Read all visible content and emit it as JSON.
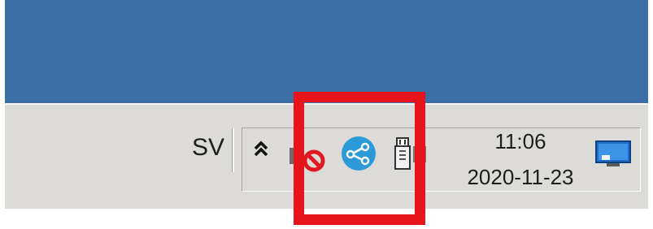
{
  "taskbar": {
    "language_label": "SV",
    "clock": {
      "time": "11:06",
      "date": "2020-11-23"
    }
  },
  "tray": {
    "icons": [
      {
        "name": "show-hidden-icons-chevron",
        "glyph": "double-chevron-up"
      },
      {
        "name": "blocked-sound-icon",
        "glyph": "no-entry"
      },
      {
        "name": "network-share-icon",
        "glyph": "share"
      },
      {
        "name": "usb-device-icon",
        "glyph": "usb-plug"
      }
    ]
  },
  "highlight": {
    "color": "#e8141c"
  },
  "colors": {
    "desktop": "#3b6ea5",
    "taskbar": "#dcdbd8",
    "share_icon": "#2d9ad8",
    "blocked_icon": "#e01820"
  }
}
